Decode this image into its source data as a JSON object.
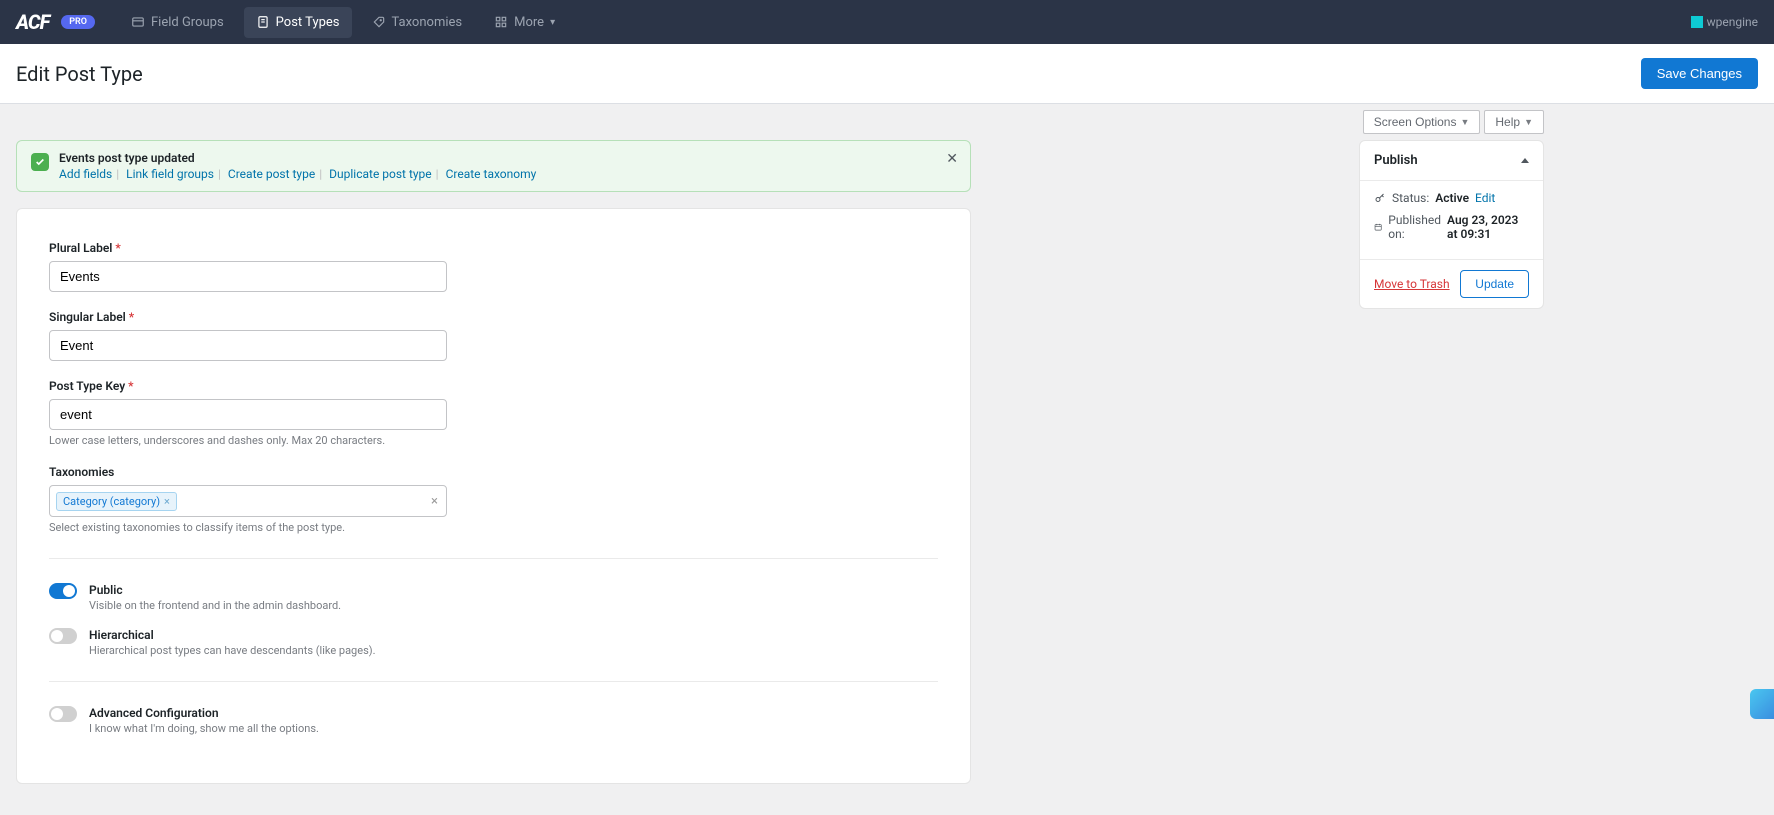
{
  "topbar": {
    "logo": "ACF",
    "badge": "PRO",
    "nav": {
      "field_groups": "Field Groups",
      "post_types": "Post Types",
      "taxonomies": "Taxonomies",
      "more": "More"
    },
    "powered": "wpengine"
  },
  "header": {
    "title": "Edit Post Type",
    "save": "Save Changes"
  },
  "screen": {
    "options": "Screen Options",
    "help": "Help"
  },
  "notice": {
    "title": "Events post type updated",
    "links": {
      "add_fields": "Add fields",
      "link_fg": "Link field groups",
      "create_pt": "Create post type",
      "dup_pt": "Duplicate post type",
      "create_tax": "Create taxonomy"
    }
  },
  "form": {
    "plural": {
      "label": "Plural Label",
      "value": "Events"
    },
    "singular": {
      "label": "Singular Label",
      "value": "Event"
    },
    "key": {
      "label": "Post Type Key",
      "value": "event",
      "help": "Lower case letters, underscores and dashes only. Max 20 characters."
    },
    "tax": {
      "label": "Taxonomies",
      "chip": "Category (category)",
      "help": "Select existing taxonomies to classify items of the post type."
    },
    "public": {
      "label": "Public",
      "desc": "Visible on the frontend and in the admin dashboard."
    },
    "hier": {
      "label": "Hierarchical",
      "desc": "Hierarchical post types can have descendants (like pages)."
    },
    "adv": {
      "label": "Advanced Configuration",
      "desc": "I know what I'm doing, show me all the options."
    }
  },
  "publish": {
    "title": "Publish",
    "status_label": "Status:",
    "status_value": "Active",
    "edit": "Edit",
    "pub_label": "Published on:",
    "pub_date": "Aug 23, 2023 at 09:31",
    "trash": "Move to Trash",
    "update": "Update"
  }
}
